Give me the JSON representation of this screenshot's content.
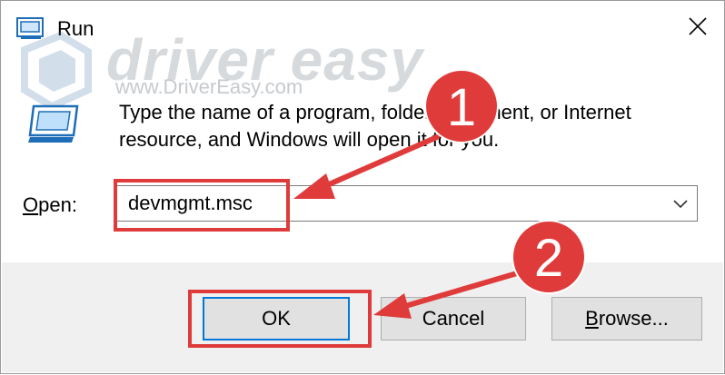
{
  "title": "Run",
  "description": "Type the name of a program, folder, document, or Internet resource, and Windows will open it for you.",
  "open_label_accel": "O",
  "open_label_rest": "pen:",
  "open_value": "devmgmt.msc",
  "buttons": {
    "ok": "OK",
    "cancel": "Cancel",
    "browse_accel": "B",
    "browse_rest": "rowse..."
  },
  "watermark": {
    "brand": "driver easy",
    "url": "www.DriverEasy.com"
  },
  "steps": [
    "1",
    "2"
  ],
  "icons": {
    "app": "run-app-icon",
    "close": "close-icon",
    "dropdown": "chevron-down-icon"
  },
  "colors": {
    "accent": "#0078d7",
    "annotation": "#e03b3b",
    "footer": "#f0f0f0"
  }
}
